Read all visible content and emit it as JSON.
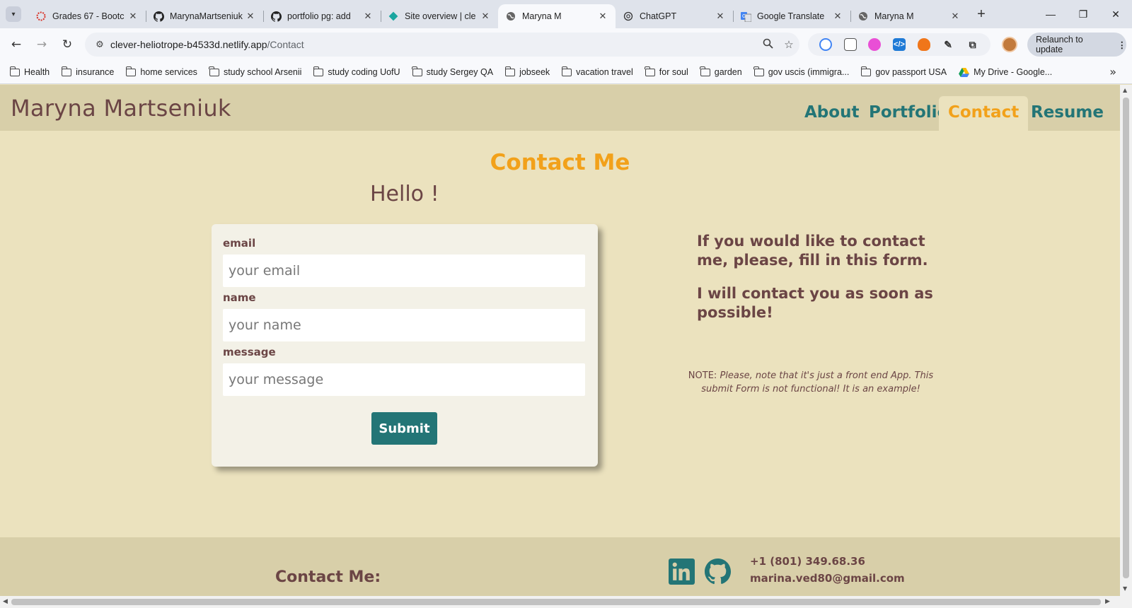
{
  "browser": {
    "tabs": [
      {
        "title": "Grades 67 - Bootc",
        "icon": "bootcamp-ring-icon",
        "active": false
      },
      {
        "title": "MarynaMartseniuk",
        "icon": "github-icon",
        "active": false
      },
      {
        "title": "portfolio pg: add",
        "icon": "github-icon",
        "active": false
      },
      {
        "title": "Site overview | cle",
        "icon": "netlify-icon",
        "active": false
      },
      {
        "title": "Maryna M",
        "icon": "globe-icon",
        "active": true
      },
      {
        "title": "ChatGPT",
        "icon": "chatgpt-icon",
        "active": false
      },
      {
        "title": "Google Translate",
        "icon": "translate-icon",
        "active": false
      },
      {
        "title": "Maryna M",
        "icon": "globe-icon",
        "active": false
      }
    ],
    "url_host": "clever-heliotrope-b4533d.netlify.app",
    "url_path": "/Contact",
    "relaunch_label": "Relaunch to update",
    "bookmarks": [
      "Health",
      "insurance",
      "home services",
      "study school Arsenii",
      "study coding UofU",
      "study Sergey QA",
      "jobseek",
      "vacation travel",
      "for soul",
      "garden",
      "gov uscis (immigra...",
      "gov passport USA"
    ],
    "drive_bookmark": "My Drive - Google..."
  },
  "site": {
    "brand": "Maryna Martseniuk",
    "nav": [
      "About",
      "Portfolio",
      "Contact",
      "Resume"
    ],
    "active_nav": "Contact",
    "colors": {
      "accent": "#f2a11a",
      "teal": "#237576",
      "text": "#6b4545",
      "bg": "#ebe2be",
      "header": "#d8cfa9"
    }
  },
  "contact": {
    "heading": "Contact Me",
    "greeting": "Hello !",
    "form": {
      "email_label": "email",
      "email_placeholder": "your email",
      "name_label": "name",
      "name_placeholder": "your name",
      "message_label": "message",
      "message_placeholder": "your message",
      "submit_label": "Submit"
    },
    "side_text_1": "If you would like to contact me, please, fill in this form.",
    "side_text_2": "I will contact you as soon as possible!",
    "note_label": "NOTE:",
    "note_body": "Please, note that it's just a front end App. This submit Form is not functional! It is an example!"
  },
  "footer": {
    "title": "Contact Me:",
    "phone": "+1 (801) 349.68.36",
    "email": "marina.ved80@gmail.com",
    "icons": [
      "linkedin-icon",
      "github-icon"
    ]
  }
}
